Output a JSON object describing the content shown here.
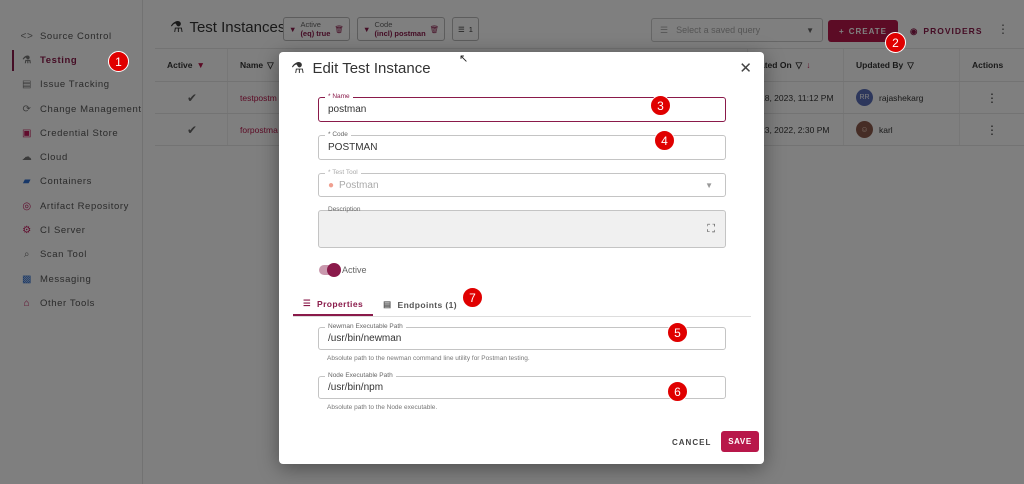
{
  "sidebar": {
    "items": [
      {
        "label": "Source Control",
        "icon": "<>",
        "active": false
      },
      {
        "label": "Testing",
        "icon": "⚗",
        "active": true
      },
      {
        "label": "Issue Tracking",
        "icon": "▤",
        "active": false
      },
      {
        "label": "Change Management",
        "icon": "⟳",
        "active": false
      },
      {
        "label": "Credential Store",
        "icon": "🔒",
        "active": false
      },
      {
        "label": "Cloud",
        "icon": "☁",
        "active": false
      },
      {
        "label": "Containers",
        "icon": "🐳",
        "active": false
      },
      {
        "label": "Artifact Repository",
        "icon": "◎",
        "active": false
      },
      {
        "label": "CI Server",
        "icon": "⚙",
        "active": false
      },
      {
        "label": "Scan Tool",
        "icon": "⌕",
        "active": false
      },
      {
        "label": "Messaging",
        "icon": "💬",
        "active": false
      },
      {
        "label": "Other Tools",
        "icon": "⌂",
        "active": false
      }
    ]
  },
  "header": {
    "title": "Test Instances",
    "chips": [
      {
        "key": "Active",
        "value": "(eq) true"
      },
      {
        "key": "Code",
        "value": "(incl) postman"
      }
    ],
    "sort_count": "1",
    "query_placeholder": "Select a saved query",
    "create_label": "CREATE",
    "providers_label": "PROVIDERS"
  },
  "table": {
    "headers": {
      "active": "Active",
      "name": "Name",
      "updated_on": "ated On",
      "updated_by": "Updated By",
      "actions": "Actions"
    },
    "rows": [
      {
        "name": "testpostm",
        "updated_on": "18, 2023, 11:12 PM",
        "avatar": "RR",
        "user": "rajashekarg"
      },
      {
        "name": "forpostma",
        "updated_on": "23, 2022, 2:30 PM",
        "avatar": "K",
        "user": "karl"
      }
    ]
  },
  "modal": {
    "title": "Edit Test Instance",
    "fields": {
      "name": {
        "label": "* Name",
        "value": "postman"
      },
      "code": {
        "label": "* Code",
        "value": "POSTMAN"
      },
      "test_tool": {
        "label": "* Test Tool",
        "value": "Postman"
      },
      "description": {
        "label": "Description",
        "value": ""
      }
    },
    "active_label": "Active",
    "tabs": [
      {
        "label": "Properties"
      },
      {
        "label": "Endpoints (1)"
      }
    ],
    "properties": {
      "newman": {
        "label": "Newman Executable Path",
        "value": "/usr/bin/newman",
        "helper": "Absolute path to the newman command line utility for Postman testing."
      },
      "node": {
        "label": "Node Executable Path",
        "value": "/usr/bin/npm",
        "helper": "Absolute path to the Node executable."
      }
    },
    "cancel_label": "CANCEL",
    "save_label": "SAVE"
  },
  "markers": [
    "1",
    "2",
    "3",
    "4",
    "5",
    "6",
    "7"
  ],
  "colors": {
    "accent": "#8a1a4a",
    "primary_button": "#b8174a",
    "marker": "#e00000"
  }
}
